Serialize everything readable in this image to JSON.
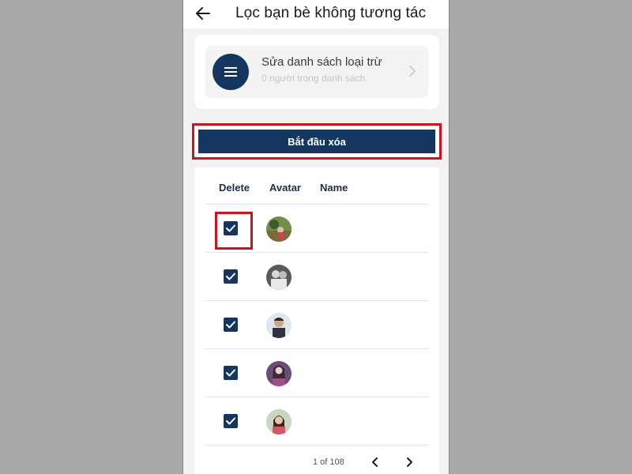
{
  "header": {
    "title": "Lọc bạn bè không tương tác",
    "back_icon": "arrow-left-icon"
  },
  "exclude_list": {
    "title": "Sửa danh sách loại trừ",
    "subtitle": "0 người trong danh sách",
    "icon": "menu-icon"
  },
  "actions": {
    "start_delete_label": "Bắt đầu xóa"
  },
  "table": {
    "columns": [
      "Delete",
      "Avatar",
      "Name"
    ],
    "rows": [
      {
        "checked": true,
        "name": ""
      },
      {
        "checked": true,
        "name": ""
      },
      {
        "checked": true,
        "name": ""
      },
      {
        "checked": true,
        "name": ""
      },
      {
        "checked": true,
        "name": ""
      }
    ]
  },
  "pagination": {
    "label": "1 of 108"
  },
  "colors": {
    "primary": "#143760",
    "highlight": "#d0121b",
    "background": "#a8a8a8"
  }
}
